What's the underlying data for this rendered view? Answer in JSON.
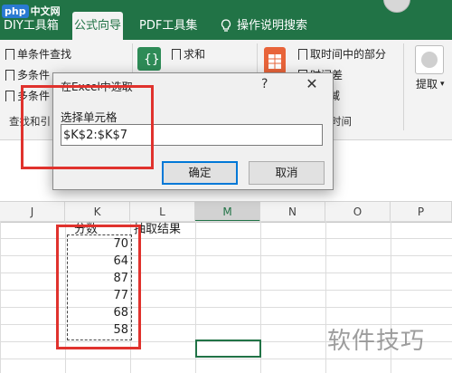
{
  "logo": {
    "badge": "php",
    "text": "中文网"
  },
  "tabs": [
    {
      "label": "DIY工具箱"
    },
    {
      "label": "公式向导"
    },
    {
      "label": "PDF工具集"
    },
    {
      "label": "操作说明搜索"
    }
  ],
  "ribbon": {
    "group1": {
      "items": [
        "单条件查找",
        "多条件",
        "多条件"
      ],
      "label": "查找和引"
    },
    "group2": {
      "items": [
        "求和"
      ]
    },
    "group3": {
      "items": [
        "取时间中的部分",
        "时间差",
        "加减"
      ],
      "label": "时间"
    },
    "extract": {
      "label": "提取"
    }
  },
  "dialog": {
    "title": "在Excel中选取",
    "help": "?",
    "close": "✕",
    "field_label": "选择单元格",
    "field_value": "$K$2:$K$7",
    "ok_label": "确定",
    "cancel_label": "取消"
  },
  "columns": [
    "J",
    "K",
    "L",
    "M",
    "N",
    "O",
    "P"
  ],
  "sheet": {
    "k_header": "分数",
    "l_header": "抽取结果",
    "scores": [
      "70",
      "64",
      "87",
      "77",
      "68",
      "58"
    ]
  },
  "watermark": "软件技巧",
  "colors": {
    "accent": "#217346",
    "highlight": "#e0322d",
    "ok_border": "#0078d7"
  }
}
